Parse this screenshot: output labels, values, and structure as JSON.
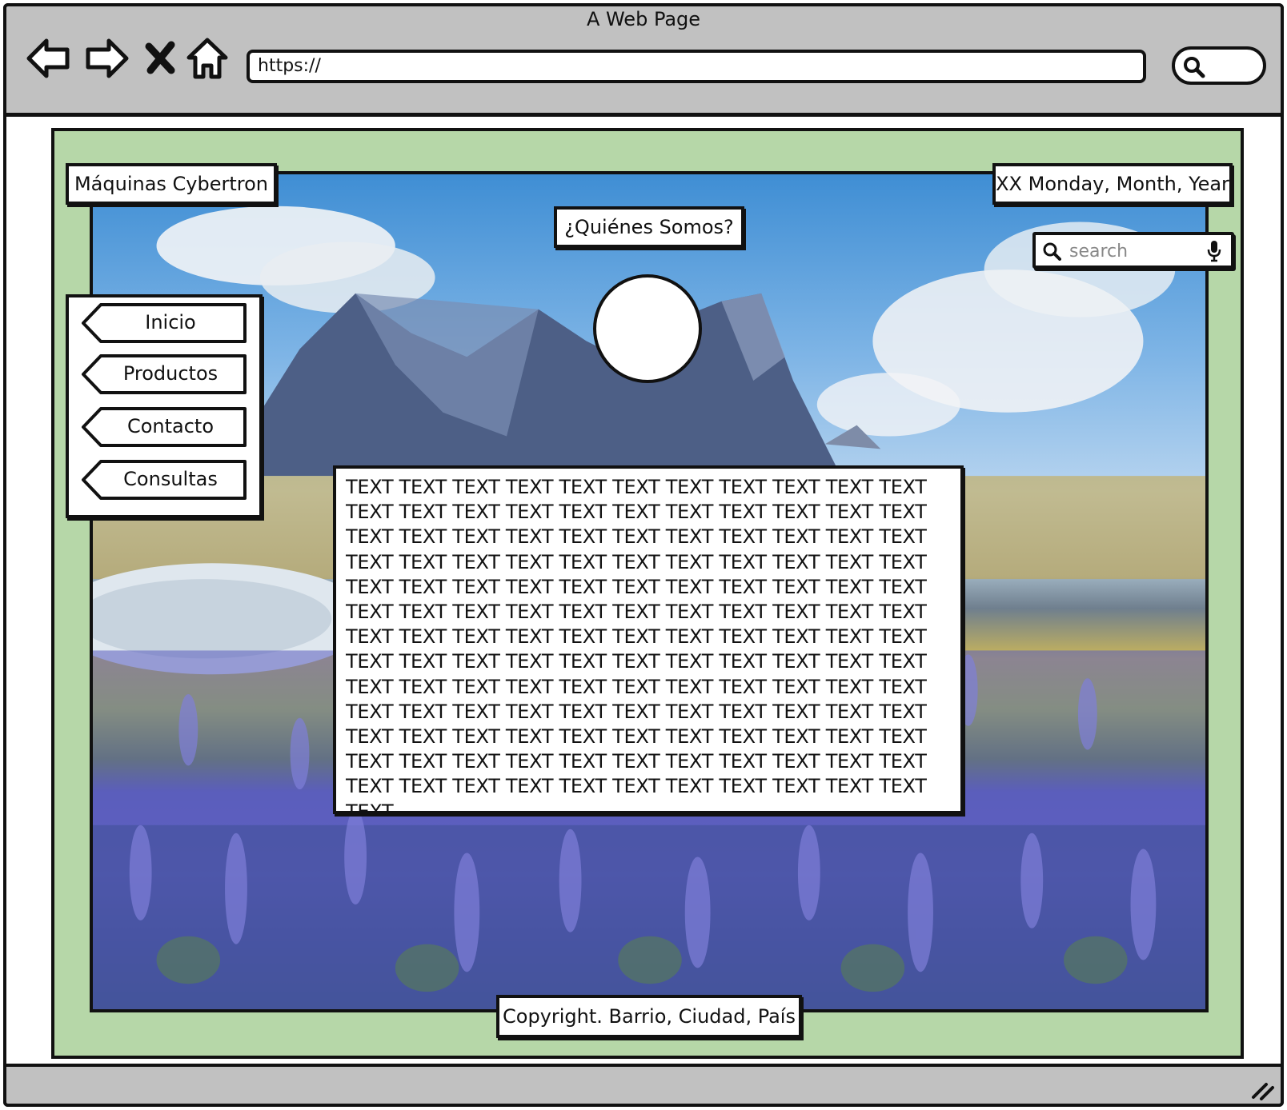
{
  "window": {
    "title": "A Web Page"
  },
  "browser": {
    "url": "https://",
    "icons": [
      "back-icon",
      "forward-icon",
      "close-icon",
      "home-icon",
      "search-icon",
      "resize-grip-icon"
    ]
  },
  "header": {
    "site_name": "Máquinas Cybertron",
    "date": "XX Monday, Month, Year",
    "search_placeholder": "search"
  },
  "main": {
    "title": "¿Quiénes Somos?",
    "body_text": "TEXT TEXT TEXT TEXT TEXT TEXT TEXT TEXT TEXT TEXT TEXT TEXT TEXT TEXT TEXT TEXT TEXT TEXT TEXT TEXT TEXT TEXT TEXT TEXT TEXT TEXT TEXT TEXT TEXT TEXT TEXT TEXT TEXT TEXT TEXT TEXT TEXT TEXT TEXT TEXT TEXT TEXT TEXT TEXT TEXT TEXT TEXT TEXT TEXT TEXT TEXT TEXT TEXT TEXT TEXT TEXT TEXT TEXT TEXT TEXT TEXT TEXT TEXT TEXT TEXT TEXT TEXT TEXT TEXT TEXT TEXT TEXT TEXT TEXT TEXT TEXT TEXT TEXT TEXT TEXT TEXT TEXT TEXT TEXT TEXT TEXT TEXT TEXT TEXT TEXT TEXT TEXT TEXT TEXT TEXT TEXT TEXT TEXT TEXT TEXT TEXT TEXT TEXT TEXT TEXT TEXT TEXT TEXT TEXT TEXT TEXT TEXT TEXT TEXT TEXT TEXT TEXT TEXT TEXT TEXT TEXT TEXT TEXT TEXT TEXT TEXT TEXT TEXT TEXT TEXT TEXT TEXT TEXT TEXT TEXT TEXT TEXT TEXT TEXT TEXT TEXT TEXT TEXT TEXT"
  },
  "nav": {
    "items": [
      {
        "label": "Inicio"
      },
      {
        "label": "Productos"
      },
      {
        "label": "Contacto"
      },
      {
        "label": "Consultas"
      }
    ]
  },
  "footer": {
    "text": "Copyright. Barrio, Ciudad, País"
  },
  "colors": {
    "chrome": "#c1c1c1",
    "page_background": "#b6d7a8",
    "border": "#111111"
  }
}
